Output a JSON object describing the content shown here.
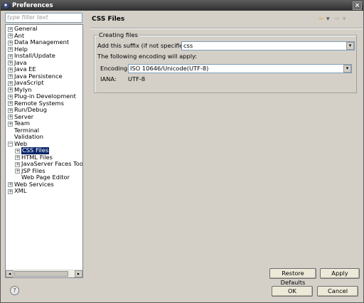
{
  "window": {
    "title": "Preferences"
  },
  "filter": {
    "placeholder": "type filter text"
  },
  "tree": [
    {
      "label": "General",
      "indent": 0,
      "expander": "+"
    },
    {
      "label": "Ant",
      "indent": 0,
      "expander": "+"
    },
    {
      "label": "Data Management",
      "indent": 0,
      "expander": "+"
    },
    {
      "label": "Help",
      "indent": 0,
      "expander": "+"
    },
    {
      "label": "Install/Update",
      "indent": 0,
      "expander": "+"
    },
    {
      "label": "Java",
      "indent": 0,
      "expander": "+"
    },
    {
      "label": "Java EE",
      "indent": 0,
      "expander": "+"
    },
    {
      "label": "Java Persistence",
      "indent": 0,
      "expander": "+"
    },
    {
      "label": "JavaScript",
      "indent": 0,
      "expander": "+"
    },
    {
      "label": "Mylyn",
      "indent": 0,
      "expander": "+"
    },
    {
      "label": "Plug-in Development",
      "indent": 0,
      "expander": "+"
    },
    {
      "label": "Remote Systems",
      "indent": 0,
      "expander": "+"
    },
    {
      "label": "Run/Debug",
      "indent": 0,
      "expander": "+"
    },
    {
      "label": "Server",
      "indent": 0,
      "expander": "+"
    },
    {
      "label": "Team",
      "indent": 0,
      "expander": "+"
    },
    {
      "label": "Terminal",
      "indent": 0,
      "expander": ""
    },
    {
      "label": "Validation",
      "indent": 0,
      "expander": ""
    },
    {
      "label": "Web",
      "indent": 0,
      "expander": "-"
    },
    {
      "label": "CSS Files",
      "indent": 1,
      "expander": "+",
      "selected": true
    },
    {
      "label": "HTML Files",
      "indent": 1,
      "expander": "+"
    },
    {
      "label": "JavaServer Faces Too",
      "indent": 1,
      "expander": "+"
    },
    {
      "label": "JSP Files",
      "indent": 1,
      "expander": "+"
    },
    {
      "label": "Web Page Editor",
      "indent": 1,
      "expander": ""
    },
    {
      "label": "Web Services",
      "indent": 0,
      "expander": "+"
    },
    {
      "label": "XML",
      "indent": 0,
      "expander": "+"
    }
  ],
  "page": {
    "title": "CSS Files",
    "back_arrow": "⇦",
    "forward_arrow": "⇨",
    "menu_arrow": "▾",
    "group_title": "Creating files",
    "suffix_label": "Add this suffix (if not specified):",
    "suffix_value": "css",
    "encoding_note": "The following encoding will apply:",
    "encoding_label": "Encoding:",
    "encoding_value": "ISO 10646/Unicode(UTF-8)",
    "iana_label": "IANA:",
    "iana_value": "UTF-8"
  },
  "buttons": {
    "restore_defaults": "Restore Defaults",
    "apply": "Apply",
    "ok": "OK",
    "cancel": "Cancel",
    "help": "?"
  },
  "colors": {
    "selection": "#0a246a",
    "titlebar": "#2e2e2e",
    "dialog_bg": "#d4d0c8",
    "back_arrow": "#e8a33a"
  }
}
